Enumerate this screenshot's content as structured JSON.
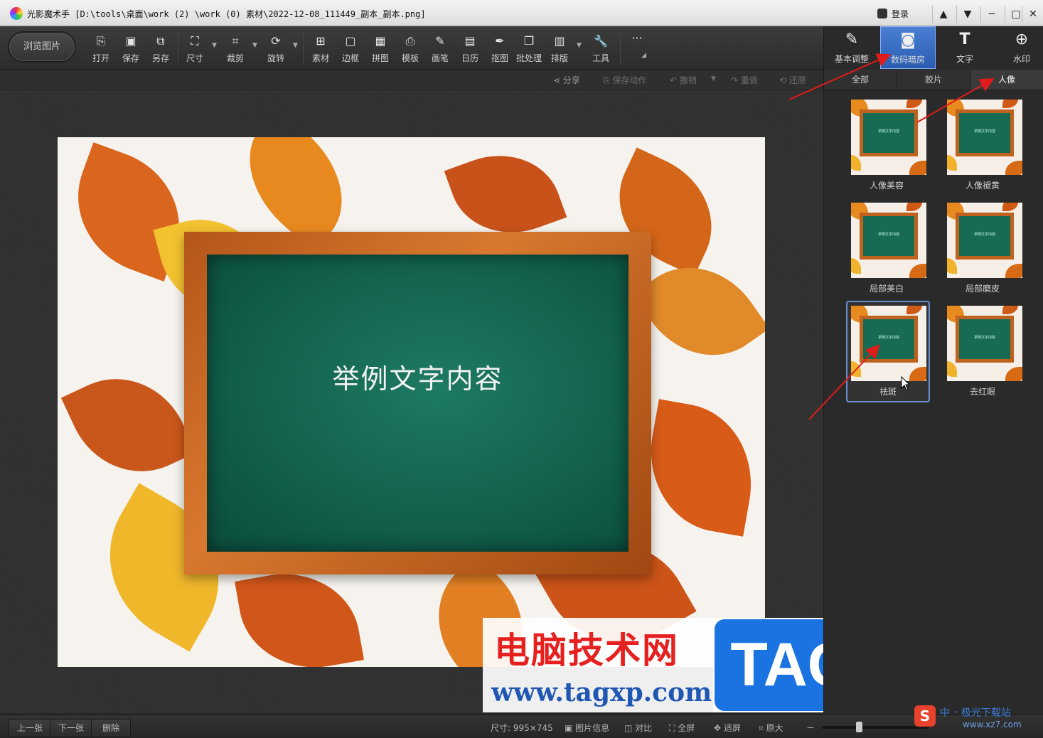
{
  "window": {
    "title": "光影魔术手  [D:\\tools\\桌面\\work (2) \\work (0) 素材\\2022-12-08_111449_副本_副本.png]",
    "login_label": "登录",
    "controls": [
      "▲",
      "▼",
      "─",
      "□",
      "✕"
    ]
  },
  "toolbar": {
    "browse_label": "浏览图片",
    "tools": [
      {
        "label": "打开",
        "icon": "open-icon"
      },
      {
        "label": "保存",
        "icon": "save-icon"
      },
      {
        "label": "另存",
        "icon": "save-as-icon"
      },
      {
        "label": "尺寸",
        "icon": "resize-icon"
      },
      {
        "label": "裁剪",
        "icon": "crop-icon"
      },
      {
        "label": "旋转",
        "icon": "rotate-icon"
      },
      {
        "label": "素材",
        "icon": "material-icon"
      },
      {
        "label": "边框",
        "icon": "border-icon"
      },
      {
        "label": "拼图",
        "icon": "collage-icon"
      },
      {
        "label": "模板",
        "icon": "template-icon"
      },
      {
        "label": "画笔",
        "icon": "brush-icon"
      },
      {
        "label": "日历",
        "icon": "calendar-icon"
      },
      {
        "label": "抠图",
        "icon": "cutout-icon"
      },
      {
        "label": "批处理",
        "icon": "batch-icon"
      },
      {
        "label": "排版",
        "icon": "layout-icon"
      },
      {
        "label": "工具",
        "icon": "wrench-icon"
      }
    ],
    "more_label": "···"
  },
  "actions": {
    "share": "分享",
    "save_action": "保存动作",
    "undo": "撤销",
    "redo": "重做",
    "restore": "还原"
  },
  "image": {
    "board_text": "举例文字内容"
  },
  "watermark": {
    "site_name": "电脑技术网",
    "url": "www.tagxp.com",
    "tag": "TAG"
  },
  "side_panel": {
    "tabs": [
      {
        "label": "基本调整",
        "icon": "adjust-icon",
        "active": false
      },
      {
        "label": "数码暗房",
        "icon": "darkroom-icon",
        "active": true
      },
      {
        "label": "文字",
        "icon": "text-icon",
        "active": false
      },
      {
        "label": "水印",
        "icon": "watermark-icon",
        "active": false
      }
    ],
    "subtabs": [
      {
        "label": "全部",
        "active": false
      },
      {
        "label": "胶片",
        "active": false
      },
      {
        "label": "人像",
        "active": true
      }
    ],
    "effects": [
      {
        "label": "人像美容",
        "selected": false
      },
      {
        "label": "人像褪黄",
        "selected": false
      },
      {
        "label": "局部美白",
        "selected": false
      },
      {
        "label": "局部磨皮",
        "selected": false
      },
      {
        "label": "祛斑",
        "selected": true
      },
      {
        "label": "去红眼",
        "selected": false
      }
    ],
    "thumb_text": "举例文字内容"
  },
  "statusbar": {
    "prev": "上一张",
    "next": "下一张",
    "delete": "删除",
    "size": "尺寸: 995×745",
    "image_info": "图片信息",
    "compare": "对比",
    "fullscreen": "全屏",
    "fit": "适屏",
    "original": "原大",
    "zoom_minus": "－",
    "zoom_level": 0.32
  },
  "corner_logo": {
    "letter": "S",
    "text": "中 ･ 极光下载站",
    "url": "www.xz7.com"
  },
  "colors": {
    "accent": "#2a5db0",
    "annotation_arrow": "#e01b1b"
  }
}
